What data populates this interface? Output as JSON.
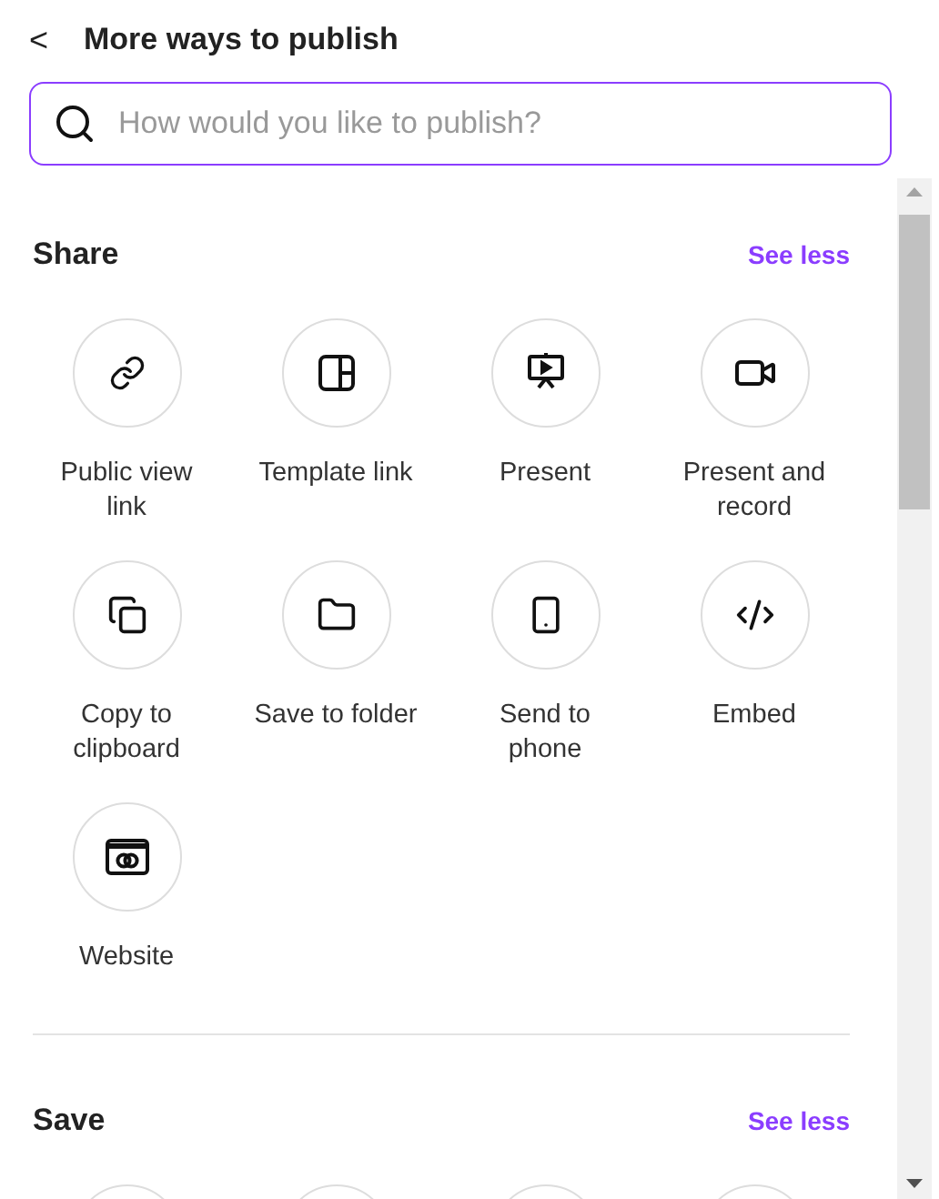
{
  "header": {
    "back": "<",
    "title": "More ways to publish"
  },
  "search": {
    "placeholder": "How would you like to publish?"
  },
  "sections": [
    {
      "title": "Share",
      "toggle": "See less",
      "items": [
        {
          "kind": "action",
          "label": "Public view link"
        },
        {
          "kind": "action",
          "label": "Template link"
        },
        {
          "kind": "action",
          "label": "Present"
        },
        {
          "kind": "action",
          "label": "Present and record"
        },
        {
          "kind": "action",
          "label": "Copy to clipboard"
        },
        {
          "kind": "action",
          "label": "Save to folder"
        },
        {
          "kind": "action",
          "label": "Send to phone"
        },
        {
          "kind": "action",
          "label": "Embed"
        },
        {
          "kind": "action",
          "label": "Website"
        }
      ]
    },
    {
      "title": "Save",
      "toggle": "See less",
      "items": [
        {
          "kind": "option"
        },
        {
          "kind": "option"
        },
        {
          "kind": "option"
        },
        {
          "kind": "option"
        }
      ]
    }
  ]
}
